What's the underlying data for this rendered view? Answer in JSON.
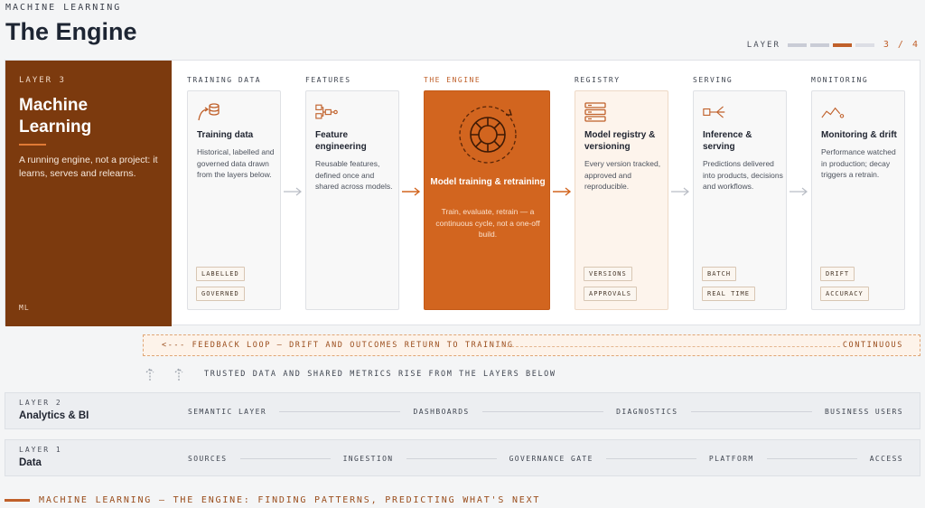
{
  "header": {
    "eyebrow": "MACHINE LEARNING",
    "title": "The Engine",
    "layer_label": "LAYER",
    "layer_fraction": "3 / 4",
    "layer_current": 3,
    "layer_total": 4
  },
  "layer3": {
    "tag": "LAYER 3",
    "name": "Machine Learning",
    "description": "A running engine, not a project: it learns, serves and relearns.",
    "code": "ML"
  },
  "stages": [
    {
      "head": "TRAINING DATA",
      "icon": "training-data-icon",
      "title": "Training data",
      "description": "Historical, labelled and governed data drawn from the layers below.",
      "chips": [
        "LABELLED",
        "GOVERNED"
      ]
    },
    {
      "head": "FEATURES",
      "icon": "features-icon",
      "title": "Feature engineering",
      "description": "Reusable features, defined once and shared across models.",
      "chips": []
    },
    {
      "head": "THE ENGINE",
      "icon": "engine-gear-icon",
      "title": "Model training & retraining",
      "description": "Train, evaluate, retrain — a continuous cycle, not a one-off build.",
      "chips": []
    },
    {
      "head": "REGISTRY",
      "icon": "registry-icon",
      "title": "Model registry & versioning",
      "description": "Every version tracked, approved and reproducible.",
      "chips": [
        "VERSIONS",
        "APPROVALS"
      ]
    },
    {
      "head": "SERVING",
      "icon": "serving-icon",
      "title": "Inference & serving",
      "description": "Predictions delivered into products, decisions and workflows.",
      "chips": [
        "BATCH",
        "REAL TIME"
      ]
    },
    {
      "head": "MONITORING",
      "icon": "monitoring-icon",
      "title": "Monitoring & drift",
      "description": "Performance watched in production; decay triggers a retrain.",
      "chips": [
        "DRIFT",
        "ACCURACY"
      ]
    }
  ],
  "feedback": {
    "text": "<--- FEEDBACK LOOP — DRIFT AND OUTCOMES RETURN TO TRAINING",
    "right": "CONTINUOUS"
  },
  "trusted": {
    "text": "TRUSTED DATA AND SHARED METRICS RISE FROM THE LAYERS BELOW"
  },
  "layer2": {
    "tag": "LAYER 2",
    "name": "Analytics & BI",
    "items": [
      "SEMANTIC LAYER",
      "DASHBOARDS",
      "DIAGNOSTICS",
      "BUSINESS USERS"
    ]
  },
  "layer1": {
    "tag": "LAYER 1",
    "name": "Data",
    "items": [
      "SOURCES",
      "INGESTION",
      "GOVERNANCE GATE",
      "PLATFORM",
      "ACCESS"
    ]
  },
  "footer": {
    "text": "MACHINE LEARNING — THE ENGINE: FINDING PATTERNS, PREDICTING WHAT'S NEXT"
  },
  "colors": {
    "accent": "#c0602a",
    "engine": "#d2651f",
    "layer3_panel": "#7c3a0e"
  }
}
